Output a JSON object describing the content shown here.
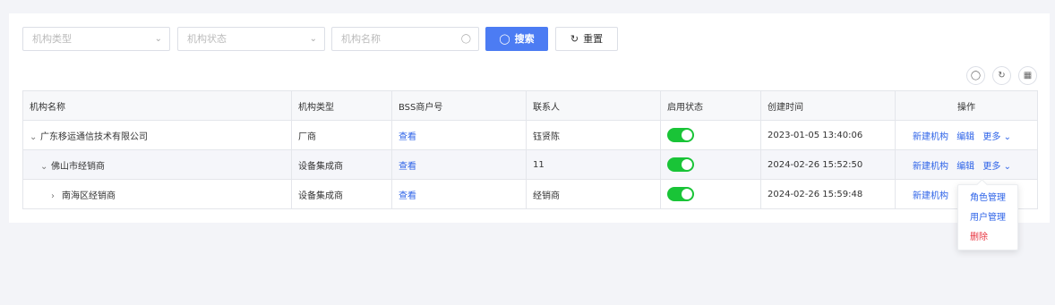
{
  "filters": {
    "type_placeholder": "机构类型",
    "status_placeholder": "机构状态",
    "name_placeholder": "机构名称",
    "search_label": "搜索",
    "reset_label": "重置"
  },
  "table": {
    "headers": [
      "机构名称",
      "机构类型",
      "BSS商户号",
      "联系人",
      "启用状态",
      "创建时间",
      "操作"
    ],
    "rows": [
      {
        "name": "广东移运通信技术有限公司",
        "type": "厂商",
        "bss": "查看",
        "contact": "钰贤陈",
        "enabled": true,
        "created": "2023-01-05 13:40:06",
        "level": 0,
        "expanded": true
      },
      {
        "name": "佛山市经销商",
        "type": "设备集成商",
        "bss": "查看",
        "contact": "11",
        "enabled": true,
        "created": "2024-02-26 15:52:50",
        "level": 1,
        "expanded": true
      },
      {
        "name": "南海区经销商",
        "type": "设备集成商",
        "bss": "查看",
        "contact": "经销商",
        "enabled": true,
        "created": "2024-02-26 15:59:48",
        "level": 2,
        "expanded": false
      }
    ],
    "actions": {
      "create": "新建机构",
      "edit": "编辑",
      "more": "更多"
    }
  },
  "more_menu": {
    "items": [
      "角色管理",
      "用户管理",
      "删除"
    ]
  },
  "colors": {
    "primary": "#4c7cf3",
    "link": "#2f64e8",
    "toggle_on": "#19c437",
    "danger": "#e8343f"
  }
}
